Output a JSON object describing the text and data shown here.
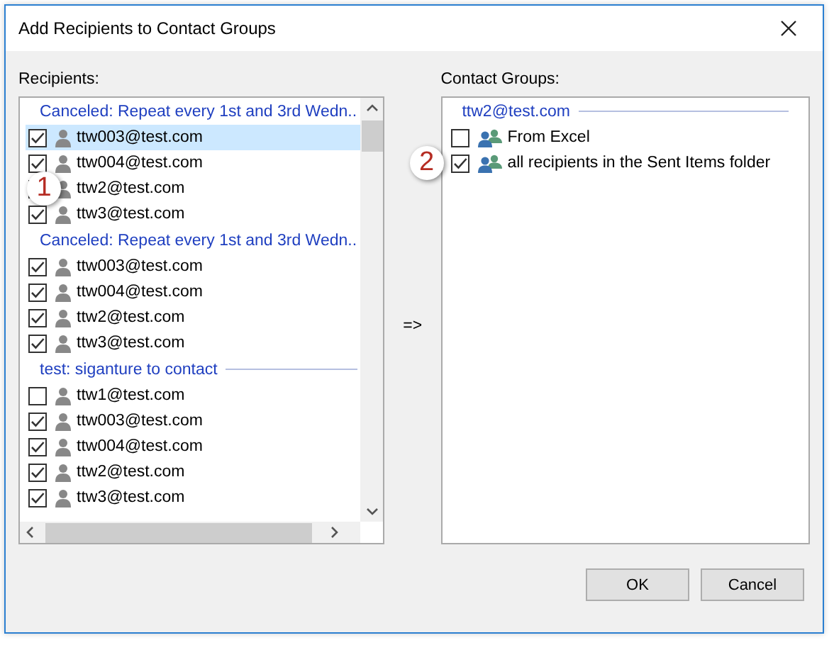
{
  "window": {
    "title": "Add Recipients to Contact Groups"
  },
  "recipients": {
    "label": "Recipients:",
    "groups": [
      {
        "title": "Canceled: Repeat every 1st and 3rd Wedn..",
        "items": [
          {
            "email": "ttw003@test.com",
            "checked": true,
            "selected": true
          },
          {
            "email": "ttw004@test.com",
            "checked": true,
            "selected": false
          },
          {
            "email": "ttw2@test.com",
            "selected": false,
            "badge": "1"
          },
          {
            "email": "ttw3@test.com",
            "checked": true,
            "selected": false
          }
        ]
      },
      {
        "title": "Canceled: Repeat every 1st and 3rd Wedn..",
        "items": [
          {
            "email": "ttw003@test.com",
            "checked": true,
            "selected": false
          },
          {
            "email": "ttw004@test.com",
            "checked": true,
            "selected": false
          },
          {
            "email": "ttw2@test.com",
            "checked": true,
            "selected": false
          },
          {
            "email": "ttw3@test.com",
            "checked": true,
            "selected": false
          }
        ]
      },
      {
        "title": "test: siganture to contact",
        "items": [
          {
            "email": "ttw1@test.com",
            "checked": false,
            "selected": false
          },
          {
            "email": "ttw003@test.com",
            "checked": true,
            "selected": false
          },
          {
            "email": "ttw004@test.com",
            "checked": true,
            "selected": false
          },
          {
            "email": "ttw2@test.com",
            "checked": true,
            "selected": false
          },
          {
            "email": "ttw3@test.com",
            "checked": true,
            "selected": false
          }
        ]
      }
    ]
  },
  "arrow": "=>",
  "contact_groups": {
    "label": "Contact Groups:",
    "groups": [
      {
        "title": "ttw2@test.com",
        "items": [
          {
            "name": "From Excel",
            "checked": false,
            "selected": false
          },
          {
            "name": "all recipients in the Sent Items folder",
            "checked": true,
            "selected": false,
            "badge": "2"
          }
        ]
      }
    ]
  },
  "buttons": [
    {
      "label": "OK"
    },
    {
      "label": "Cancel"
    }
  ]
}
